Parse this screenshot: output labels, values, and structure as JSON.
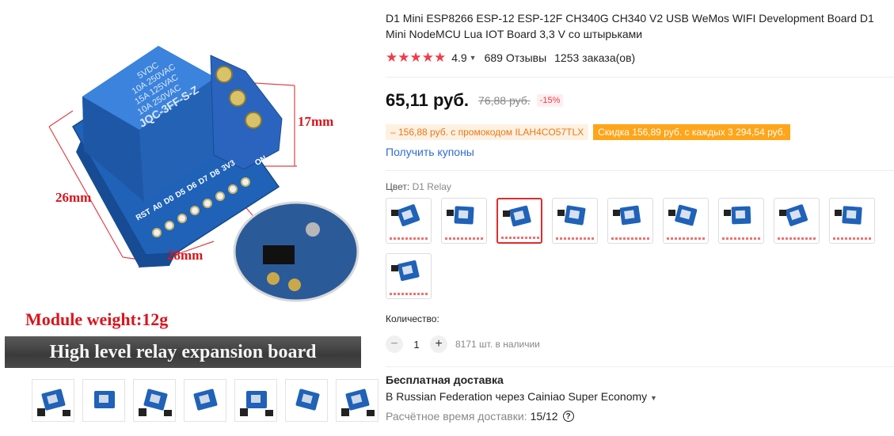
{
  "gallery": {
    "dimensions": {
      "height": "17mm",
      "width": "26mm",
      "depth": "28mm"
    },
    "relay_markings": [
      "5VDC",
      "10A 250VAC",
      "15A 125VAC",
      "10A 250VAC",
      "JQC-3FF-S-Z"
    ],
    "pin_labels": [
      "RST",
      "A0",
      "D0",
      "D5",
      "D6",
      "D7",
      "D8",
      "3V3"
    ],
    "on_label": "ON",
    "weight_text": "Module weight:12g",
    "banner_text": "High level relay expansion board",
    "thumbnails": 7
  },
  "product": {
    "title": "D1 Mini ESP8266 ESP-12 ESP-12F CH340G CH340 V2 USB WeMos WIFI Development Board D1 Mini NodeMCU Lua IOT Board 3,3 V со штырьками",
    "rating": {
      "stars": "★★★★★",
      "value": "4.9",
      "reviews": "689 Отзывы",
      "orders": "1253 заказа(ов)"
    },
    "price": {
      "current": "65,11 руб.",
      "old": "76,88 руб.",
      "discount": "-15%"
    },
    "promo": {
      "code_text": "– 156,88 руб. с промокодом ILAH4CO57TLX",
      "discount_text": "Скидка 156,89 руб. с каждых 3 294,54 руб."
    },
    "coupons_link": "Получить купоны",
    "color": {
      "label": "Цвет:",
      "value": "D1 Relay",
      "selected_index": 2,
      "swatch_count": 10
    },
    "quantity": {
      "label": "Количество:",
      "value": "1",
      "minus": "−",
      "plus": "+",
      "stock": "8171 шт. в наличии"
    },
    "shipping": {
      "title": "Бесплатная доставка",
      "destination": "В Russian Federation через Cainiao Super Economy",
      "time_label": "Расчётное время доставки:",
      "time_value": "15/12"
    }
  },
  "colors": {
    "accent_red": "#f13b45",
    "link_blue": "#2f6cd4",
    "promo_orange": "#ffa51a",
    "board_blue": "#1f62b8",
    "dimension_red": "#e0424a"
  }
}
